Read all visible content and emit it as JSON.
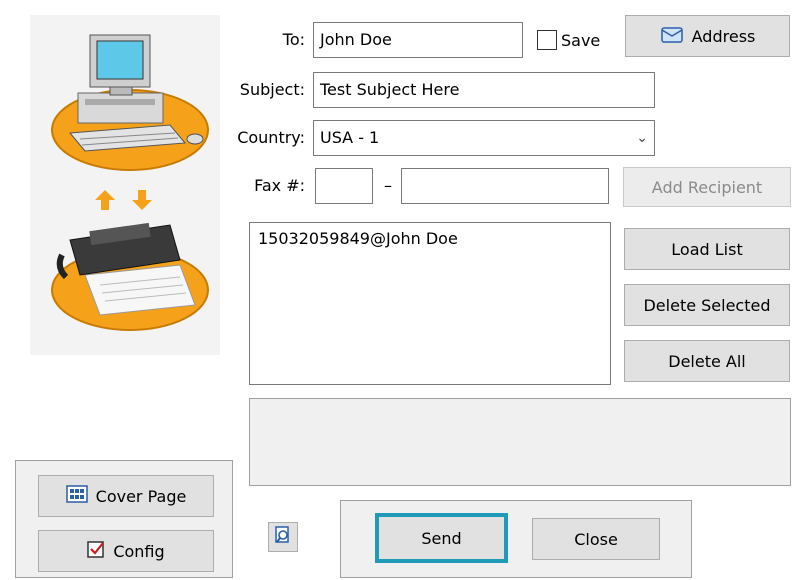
{
  "form": {
    "to_label": "To:",
    "to_value": "John Doe",
    "save_label": "Save",
    "address_label": "Address",
    "subject_label": "Subject:",
    "subject_value": "Test Subject Here",
    "country_label": "Country:",
    "country_value": "USA - 1",
    "fax_label": "Fax #:",
    "fax_area": "",
    "fax_separator": "–",
    "fax_number": "",
    "add_recipient_label": "Add Recipient"
  },
  "recipients": {
    "items": [
      "15032059849@John Doe"
    ]
  },
  "side_buttons": {
    "load_list": "Load List",
    "delete_selected": "Delete Selected",
    "delete_all": "Delete All"
  },
  "bottom_left": {
    "cover_page": "Cover Page",
    "config": "Config"
  },
  "actions": {
    "send": "Send",
    "close": "Close"
  },
  "colors": {
    "accent_send_border": "#1f9bb8",
    "orange": "#f5a21a"
  }
}
